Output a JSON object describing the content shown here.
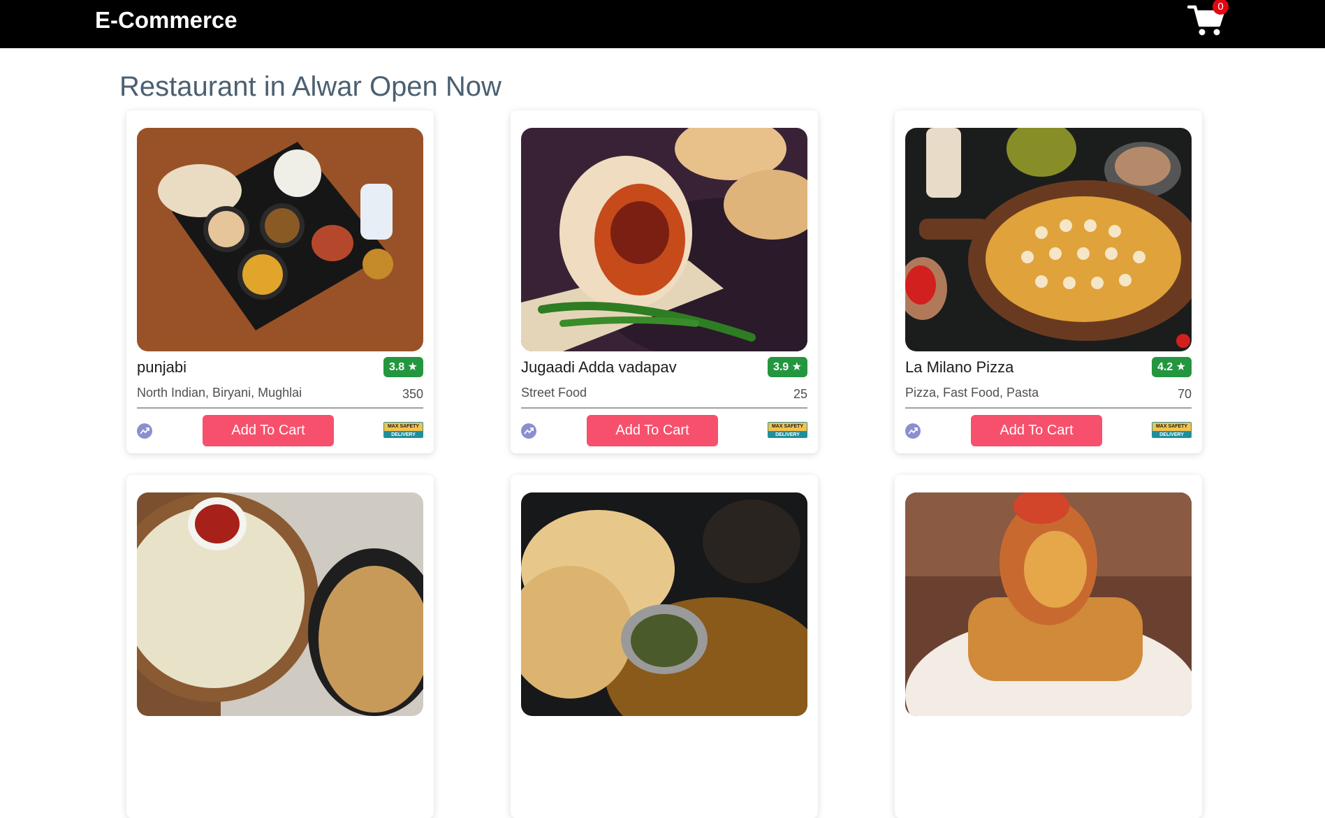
{
  "navbar": {
    "brand": "E-Commerce",
    "cart_count": "0"
  },
  "heading": "Restaurant in Alwar Open Now",
  "button_label": "Add To Cart",
  "badge": {
    "top": "MAX SAFETY",
    "bottom": "DELIVERY"
  },
  "restaurants": [
    {
      "name": "punjabi",
      "rating": "3.8",
      "cuisine": "North Indian, Biryani, Mughlai",
      "price": "350"
    },
    {
      "name": "Jugaadi Adda vadapav",
      "rating": "3.9",
      "cuisine": "Street Food",
      "price": "25"
    },
    {
      "name": "La Milano Pizza",
      "rating": "4.2",
      "cuisine": "Pizza, Fast Food, Pasta",
      "price": "70"
    }
  ],
  "colors": {
    "navbar": "#000000",
    "accent": "#f7506c",
    "rating": "#24963f",
    "heading": "#4b6072"
  },
  "icons": {
    "cart": "cart-icon",
    "star": "star-icon",
    "trend": "trend-icon"
  }
}
